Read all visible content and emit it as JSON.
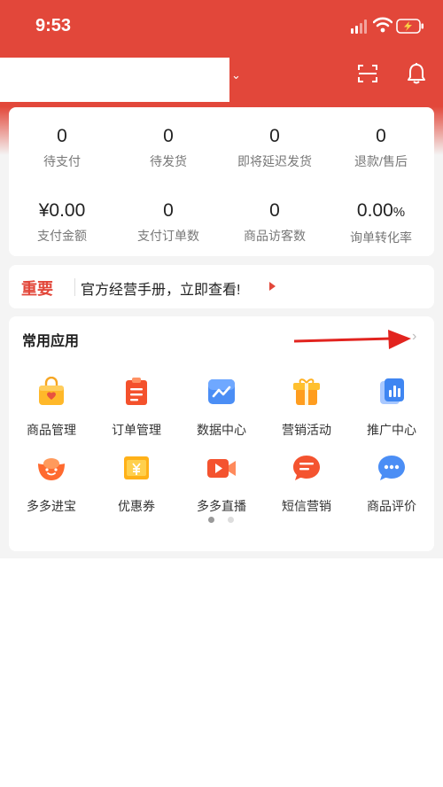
{
  "status_bar": {
    "time": "9:53"
  },
  "header": {
    "shop_name": "",
    "caret": "⌄"
  },
  "stats": {
    "row1": [
      {
        "value": "0",
        "label": "待支付"
      },
      {
        "value": "0",
        "label": "待发货"
      },
      {
        "value": "0",
        "label": "即将延迟发货"
      },
      {
        "value": "0",
        "label": "退款/售后"
      }
    ],
    "row2": [
      {
        "value": "¥0.00",
        "label": "支付金额"
      },
      {
        "value": "0",
        "label": "支付订单数"
      },
      {
        "value": "0",
        "label": "商品访客数"
      },
      {
        "value": "0.00",
        "unit": "%",
        "label": "询单转化率"
      }
    ]
  },
  "notice": {
    "tag": "重要",
    "text": "官方经营手册，立即查看!"
  },
  "apps": {
    "title": "常用应用",
    "more": "›",
    "items": [
      {
        "label": "商品管理",
        "icon": "shopping-bag-icon"
      },
      {
        "label": "订单管理",
        "icon": "clipboard-icon"
      },
      {
        "label": "数据中心",
        "icon": "chart-line-icon"
      },
      {
        "label": "营销活动",
        "icon": "gift-icon"
      },
      {
        "label": "推广中心",
        "icon": "bar-chart-icon"
      },
      {
        "label": "多多进宝",
        "icon": "ingot-icon"
      },
      {
        "label": "优惠券",
        "icon": "coupon-icon"
      },
      {
        "label": "多多直播",
        "icon": "video-icon"
      },
      {
        "label": "短信营销",
        "icon": "message-icon"
      },
      {
        "label": "商品评价",
        "icon": "comment-icon"
      }
    ],
    "page_indicator": {
      "current": 1,
      "total": 2
    }
  },
  "colors": {
    "brand_red": "#e2473a",
    "orange": "#ff8a2a",
    "blue": "#4b8ef5"
  }
}
